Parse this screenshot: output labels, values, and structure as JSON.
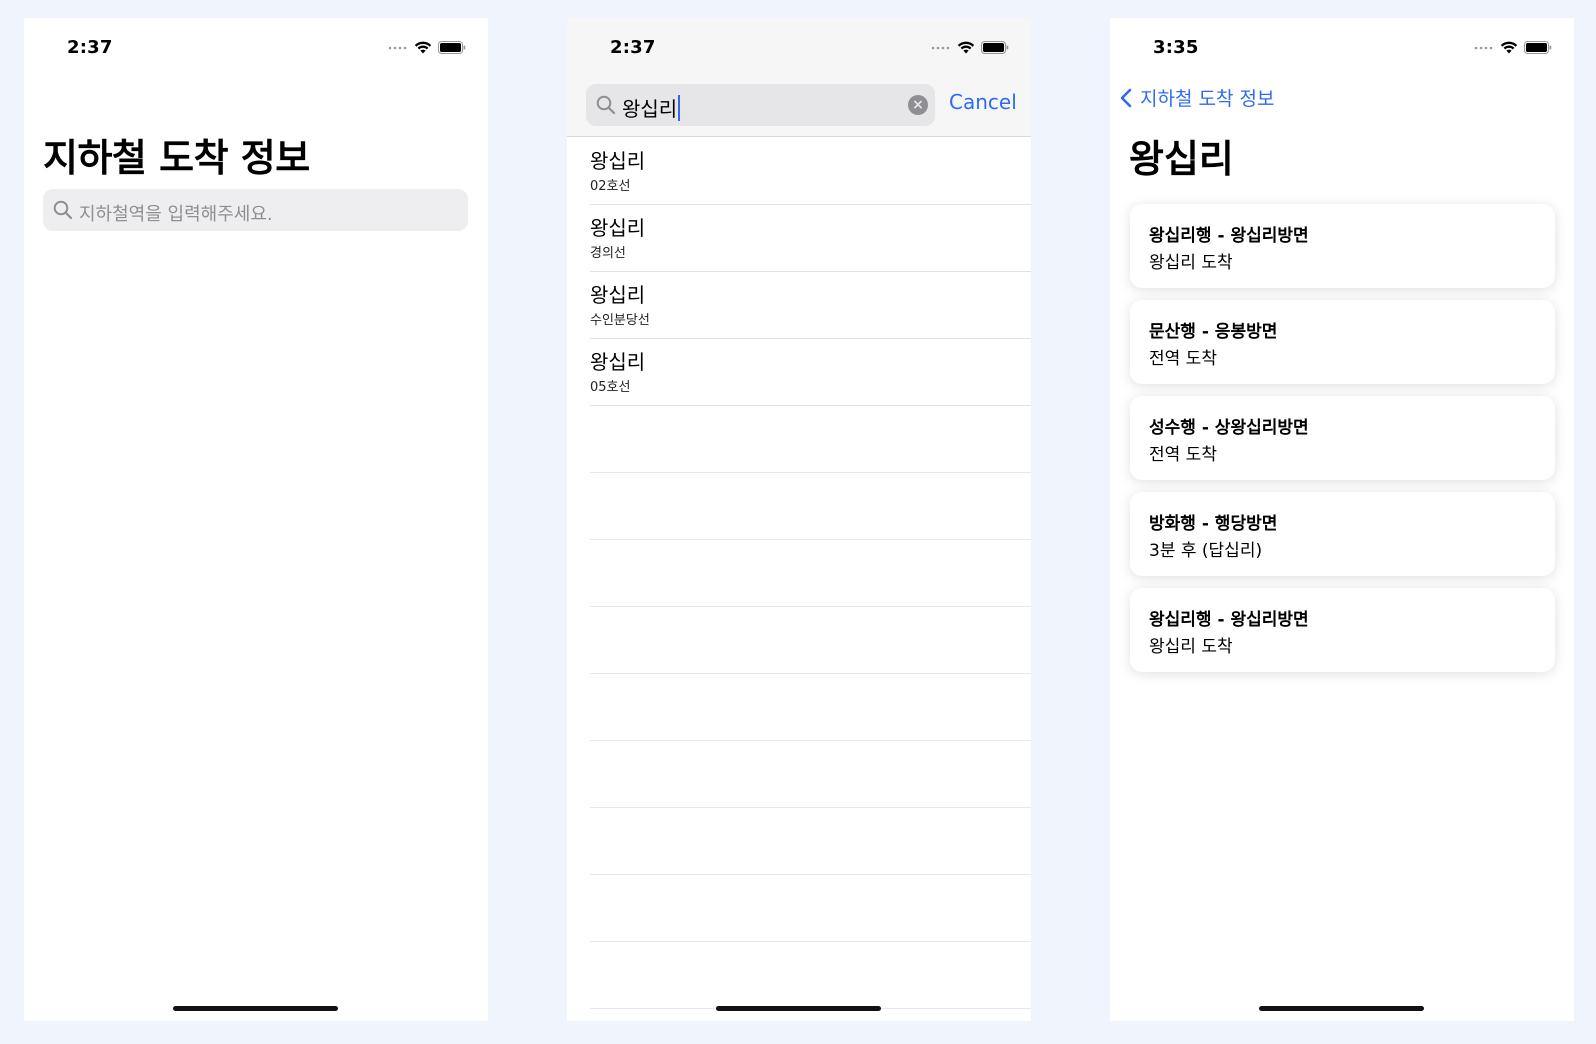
{
  "screen1": {
    "time": "2:37",
    "title": "지하철 도착 정보",
    "search_placeholder": "지하철역을 입력해주세요."
  },
  "screen2": {
    "time": "2:37",
    "search_value": "왕십리",
    "cancel_label": "Cancel",
    "results": [
      {
        "name": "왕십리",
        "line": "02호선"
      },
      {
        "name": "왕십리",
        "line": "경의선"
      },
      {
        "name": "왕십리",
        "line": "수인분당선"
      },
      {
        "name": "왕십리",
        "line": "05호선"
      }
    ]
  },
  "screen3": {
    "time": "3:35",
    "back_label": "지하철 도착 정보",
    "title": "왕십리",
    "arrivals": [
      {
        "direction": "왕십리행 - 왕십리방면",
        "arrival": "왕십리 도착"
      },
      {
        "direction": "문산행 - 응봉방면",
        "arrival": "전역 도착"
      },
      {
        "direction": "성수행 - 상왕십리방면",
        "arrival": "전역 도착"
      },
      {
        "direction": "방화행 - 행당방면",
        "arrival": "3분 후 (답십리)"
      },
      {
        "direction": "왕십리행 - 왕십리방면",
        "arrival": "왕십리 도착"
      }
    ]
  },
  "icons": {
    "signal": "signal-dots-icon",
    "wifi": "wifi-icon",
    "battery": "battery-icon",
    "search": "search-icon",
    "clear": "clear-icon",
    "back": "chevron-left-icon"
  },
  "colors": {
    "background": "#f0f4fc",
    "accent": "#2f6bf0",
    "placeholder": "#8e8e93"
  }
}
